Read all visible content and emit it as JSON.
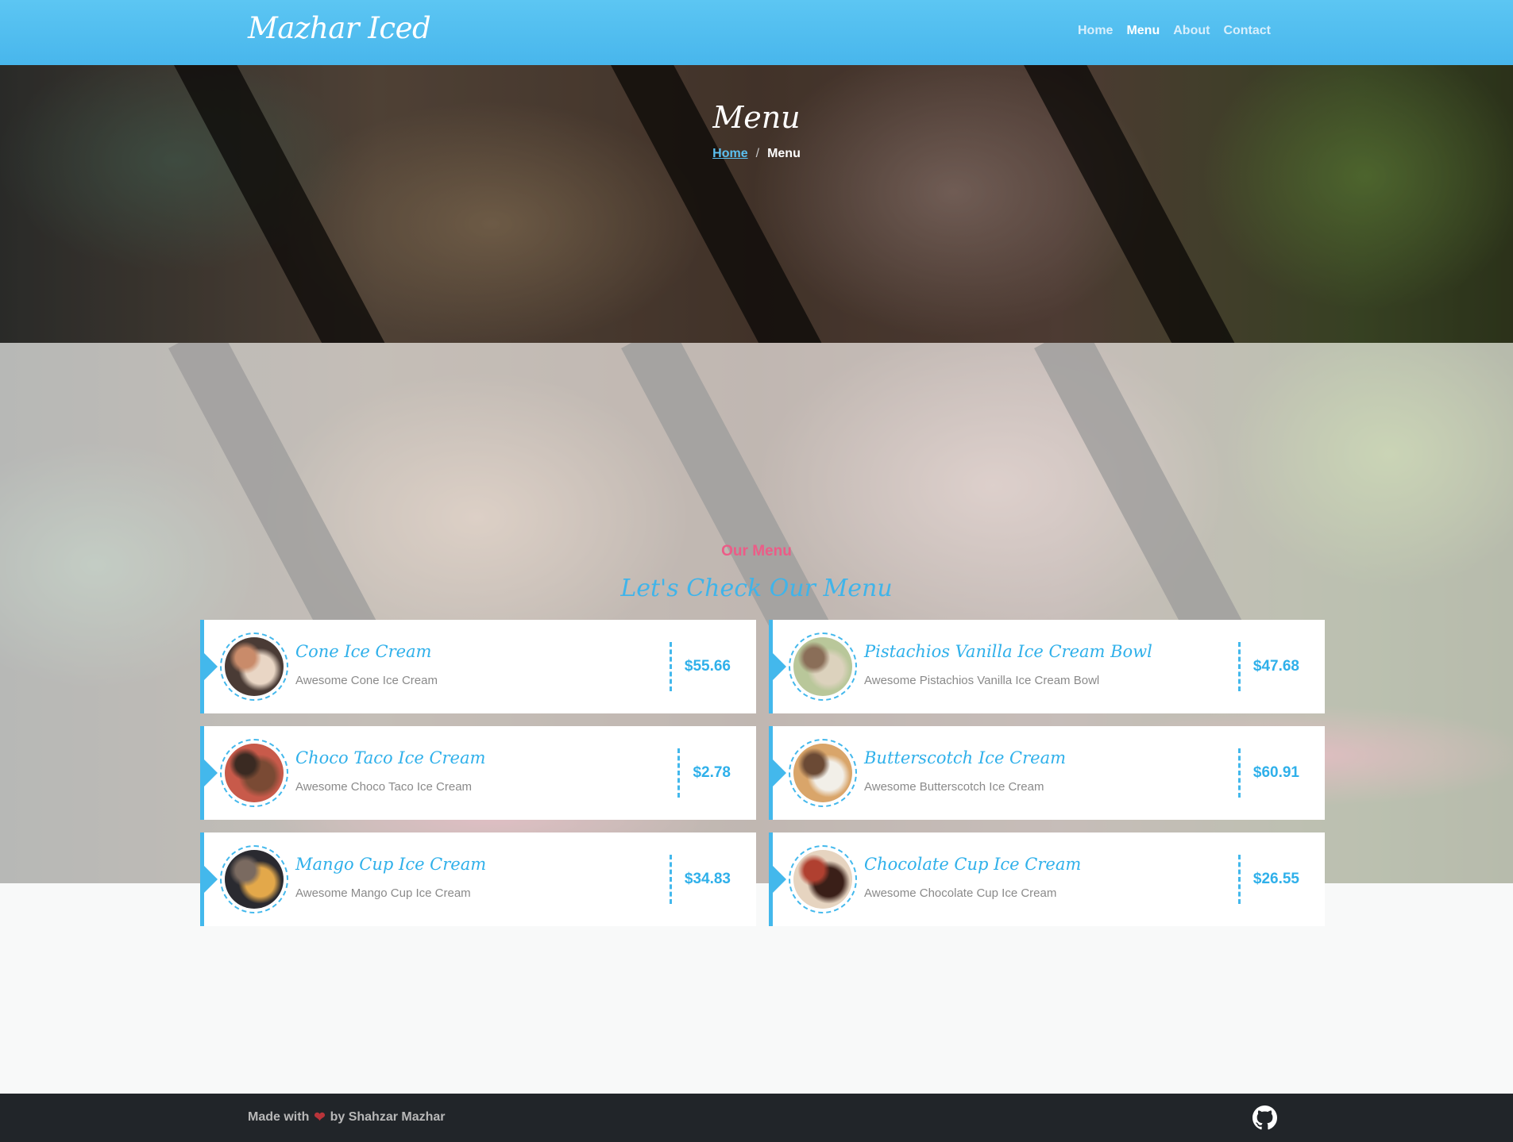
{
  "nav": {
    "brand": "Mazhar Iced",
    "links": [
      "Home",
      "Menu",
      "About",
      "Contact"
    ],
    "active": "Menu"
  },
  "hero": {
    "title": "Menu",
    "breadcrumb": {
      "home": "Home",
      "separator": "/",
      "current": "Menu"
    }
  },
  "section": {
    "subtitle": "Our Menu",
    "title": "Let's Check Our Menu"
  },
  "menu_items": [
    {
      "name": "Cone Ice Cream",
      "desc": "Awesome Cone Ice Cream",
      "price": "$55.66",
      "thumb_colors": [
        "#e9d6c5",
        "#4a3b35",
        "#c98b6a"
      ]
    },
    {
      "name": "Pistachios Vanilla Ice Cream Bowl",
      "desc": "Awesome Pistachios Vanilla Ice Cream Bowl",
      "price": "$47.68",
      "thumb_colors": [
        "#dcd2bd",
        "#b9c79a",
        "#8a6e58"
      ]
    },
    {
      "name": "Choco Taco Ice Cream",
      "desc": "Awesome Choco Taco Ice Cream",
      "price": "$2.78",
      "thumb_colors": [
        "#7a4a34",
        "#c85a4a",
        "#3a2a22"
      ]
    },
    {
      "name": "Butterscotch Ice Cream",
      "desc": "Awesome Butterscotch Ice Cream",
      "price": "$60.91",
      "thumb_colors": [
        "#f2efe8",
        "#d9a56a",
        "#6b4a35"
      ]
    },
    {
      "name": "Mango Cup Ice Cream",
      "desc": "Awesome Mango Cup Ice Cream",
      "price": "$34.83",
      "thumb_colors": [
        "#e3a84a",
        "#2a2a30",
        "#7a6a60"
      ]
    },
    {
      "name": "Chocolate Cup Ice Cream",
      "desc": "Awesome Chocolate Cup Ice Cream",
      "price": "$26.55",
      "thumb_colors": [
        "#3a1f18",
        "#e6d4c0",
        "#b04030"
      ]
    }
  ],
  "footer": {
    "made_with": "Made with",
    "by": "by Shahzar Mazhar",
    "icon": "github-icon"
  },
  "colors": {
    "primary": "#43b8ec",
    "accent_pink": "#ec5c87",
    "footer_bg": "#212529"
  }
}
